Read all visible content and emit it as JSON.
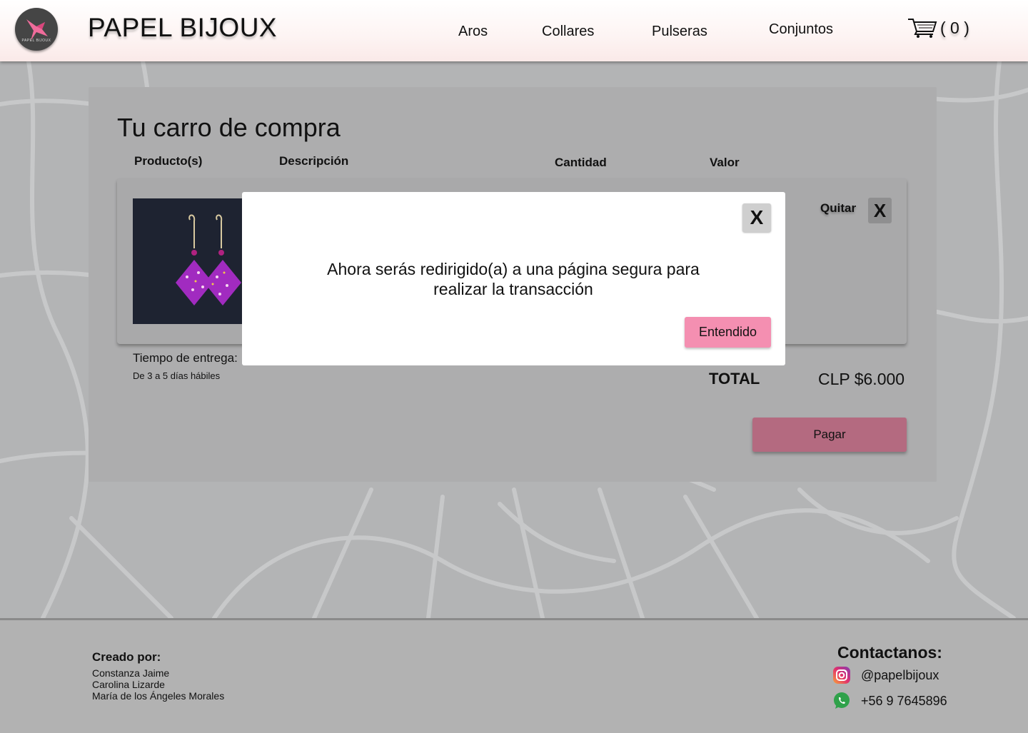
{
  "header": {
    "brand": "PAPEL BIJOUX",
    "logo_text": "PAPEL BIJOUX",
    "nav": [
      "Aros",
      "Collares",
      "Pulseras",
      "Conjuntos"
    ],
    "cart_count": "( 0 )"
  },
  "cart": {
    "title": "Tu carro de compra",
    "columns": [
      "Producto(s)",
      "Descripción",
      "Cantidad",
      "Valor"
    ],
    "remove_label": "Quitar",
    "remove_button": "X",
    "delivery_label": "Tiempo de entrega:",
    "delivery_value": "De 3 a 5 días hábiles",
    "total_label": "TOTAL",
    "total_value": "CLP $6.000",
    "pay_button": "Pagar"
  },
  "modal": {
    "close": "X",
    "message": "Ahora serás redirigido(a) a una página segura para realizar la transacción",
    "ok_button": "Entendido"
  },
  "footer": {
    "credits_title": "Creado por:",
    "credits": [
      "Constanza Jaime",
      "Carolina Lizarde",
      "María de los Ángeles Morales"
    ],
    "contact_title": "Contactanos:",
    "instagram": "@papelbijoux",
    "whatsapp": "+56 9 7645896"
  },
  "colors": {
    "header_bg": "#fdf4f3",
    "accent_pink": "#f48fb1",
    "pay_button": "#b46a80",
    "panel_bg": "#adadae"
  },
  "icons": [
    "logo-bird-icon",
    "cart-icon",
    "instagram-icon",
    "whatsapp-icon",
    "close-icon"
  ]
}
